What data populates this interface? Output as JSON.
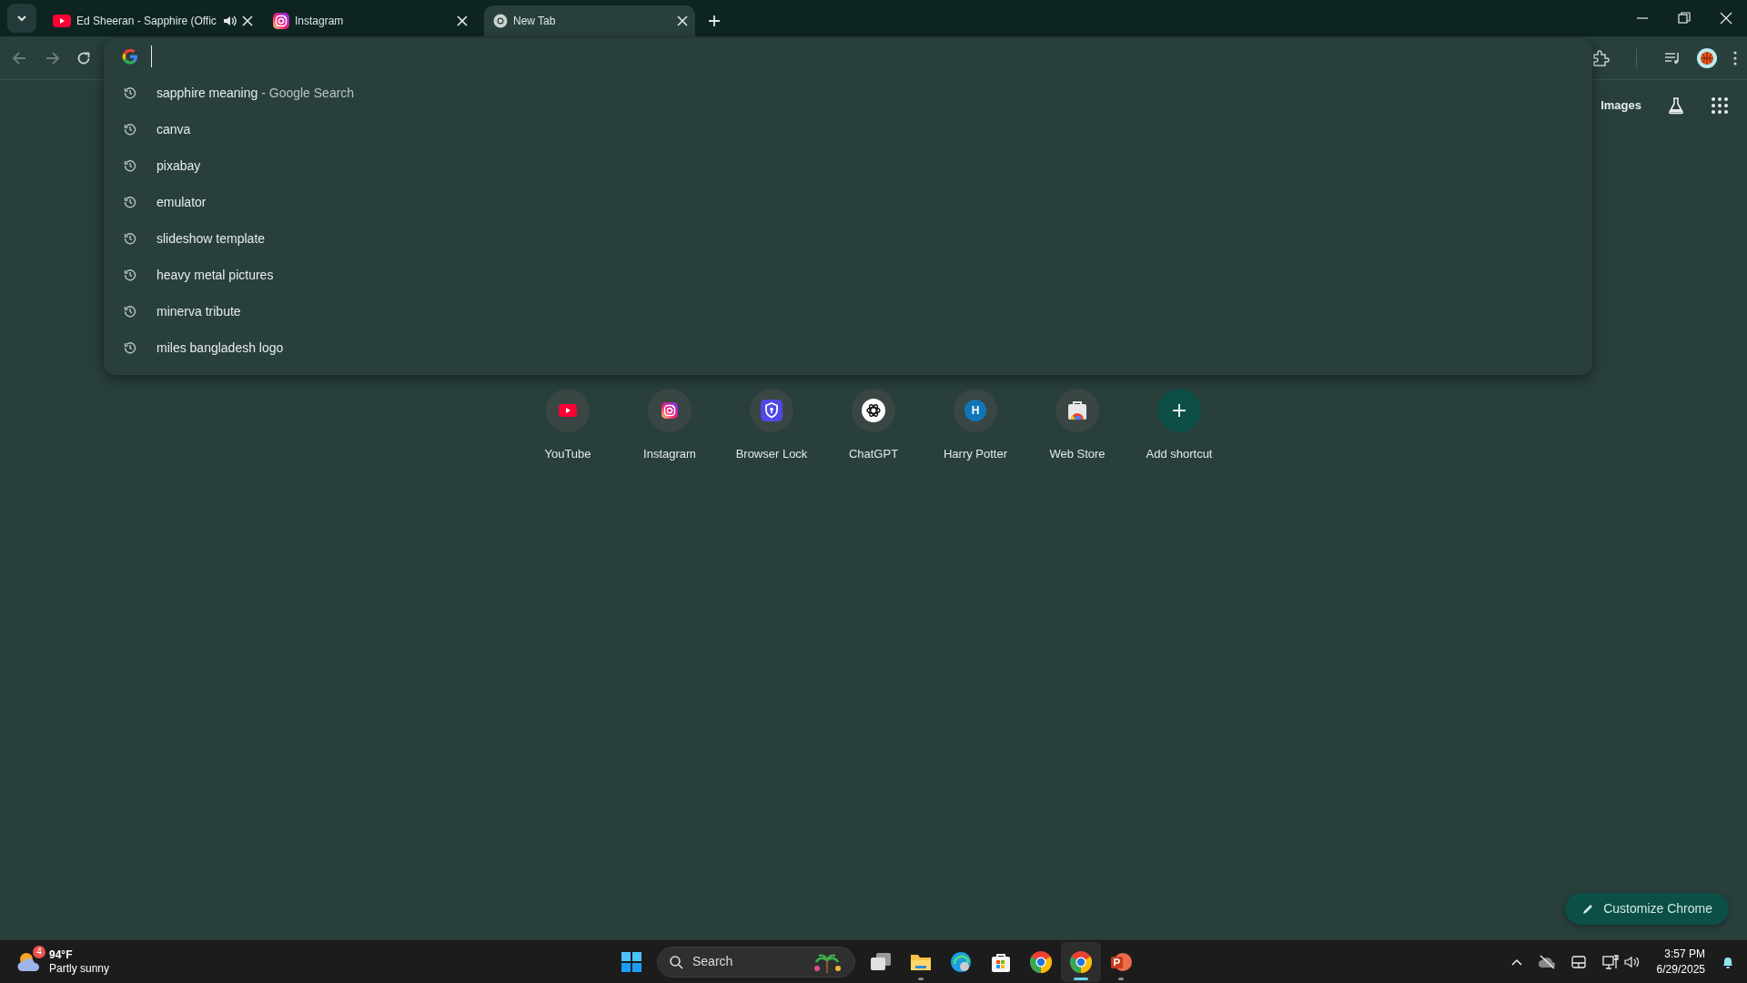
{
  "tabs": [
    {
      "title": "Ed Sheeran - Sapphire (Offic",
      "kind": "youtube",
      "audio": true,
      "selected": false
    },
    {
      "title": "Instagram",
      "kind": "instagram",
      "audio": false,
      "selected": false
    },
    {
      "title": "New Tab",
      "kind": "chrome",
      "audio": false,
      "selected": true
    }
  ],
  "nav_buttons": [
    {
      "kind": "back",
      "disabled": true
    },
    {
      "kind": "forward",
      "disabled": true
    },
    {
      "kind": "reload",
      "disabled": false
    }
  ],
  "suggestions": [
    {
      "text": "sapphire meaning",
      "detail": "- Google Search"
    },
    {
      "text": "canva"
    },
    {
      "text": "pixabay"
    },
    {
      "text": "emulator"
    },
    {
      "text": "slideshow template"
    },
    {
      "text": "heavy metal pictures"
    },
    {
      "text": "minerva tribute"
    },
    {
      "text": "miles bangladesh logo"
    }
  ],
  "header_link": "Images",
  "shortcuts": [
    {
      "label": "YouTube",
      "kind": "youtube"
    },
    {
      "label": "Instagram",
      "kind": "instagram"
    },
    {
      "label": "Browser Lock",
      "kind": "shield"
    },
    {
      "label": "ChatGPT",
      "kind": "knot"
    },
    {
      "label": "Harry Potter",
      "kind": "letter",
      "letter": "H"
    },
    {
      "label": "Web Store",
      "kind": "store"
    },
    {
      "label": "Add shortcut",
      "kind": "add"
    }
  ],
  "customize_button": "Customize Chrome",
  "taskbar": {
    "weather": {
      "badge": "4",
      "temperature": "94°F",
      "condition": "Partly sunny"
    },
    "search": {
      "placeholder": "Search"
    },
    "apps": [
      {
        "kind": "start",
        "running": false,
        "selected": false
      },
      {
        "kind": "taskview",
        "running": false,
        "selected": false
      },
      {
        "kind": "folder",
        "running": true,
        "selected": false
      },
      {
        "kind": "edge",
        "running": false,
        "selected": false
      },
      {
        "kind": "store",
        "running": false,
        "selected": false
      },
      {
        "kind": "chrome",
        "running": false,
        "selected": false
      },
      {
        "kind": "chrome",
        "running": true,
        "selected": true
      },
      {
        "kind": "powerpoint",
        "running": true,
        "selected": false
      }
    ],
    "clock": {
      "time": "3:57 PM",
      "date": "6/29/2025"
    }
  }
}
